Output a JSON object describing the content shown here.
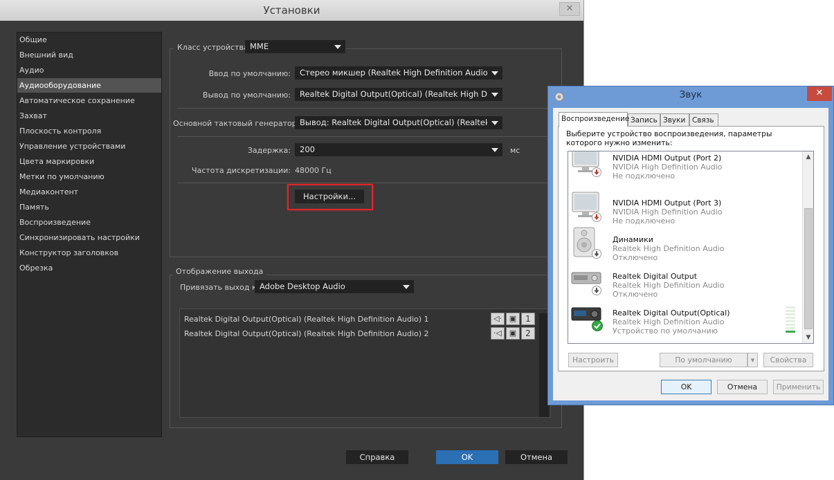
{
  "prefs": {
    "title": "Установки",
    "categories": [
      "Общие",
      "Внешний вид",
      "Аудио",
      "Аудиооборудование",
      "Автоматическое сохранение",
      "Захват",
      "Плоскость контроля",
      "Управление устройствами",
      "Цвета маркировки",
      "Метки по умолчанию",
      "Медиаконтент",
      "Память",
      "Воспроизведение",
      "Синхронизировать настройки",
      "Конструктор заголовков",
      "Обрезка"
    ],
    "selected_category": "Аудиооборудование",
    "device_class_label": "Класс устройства:",
    "device_class_value": "MME",
    "default_input_label": "Ввод по умолчанию:",
    "default_input_value": "Стерео микшер (Realtek High Definition Audio)",
    "default_output_label": "Вывод по умолчанию:",
    "default_output_value": "Realtek Digital Output(Optical) (Realtek High Definition Audio)",
    "master_clock_label": "Основной тактовый генератор:",
    "master_clock_value": "Вывод: Realtek Digital Output(Optical) (Realtek High Definition Audio)",
    "latency_label": "Задержка:",
    "latency_value": "200",
    "latency_unit": "мс",
    "sample_rate_label": "Частота дискретизации:",
    "sample_rate_value": "48000 Гц",
    "settings_button": "Настройки...",
    "output_mapping_title": "Отображение выхода",
    "map_output_label": "Привязать выход к:",
    "map_output_value": "Adobe Desktop Audio",
    "outputs": [
      {
        "name": "Realtek Digital Output(Optical) (Realtek High Definition Audio) 1",
        "channel": "1"
      },
      {
        "name": "Realtek Digital Output(Optical) (Realtek High Definition Audio) 2",
        "channel": "2"
      }
    ],
    "help_button": "Справка",
    "ok_button": "OK",
    "cancel_button": "Отмена",
    "highlight_color": "#e0262b"
  },
  "sound": {
    "title": "Звук",
    "tabs": [
      "Воспроизведение",
      "Запись",
      "Звуки",
      "Связь"
    ],
    "active_tab": "Воспроизведение",
    "description": "Выберите устройство воспроизведения, параметры которого нужно изменить:",
    "devices": [
      {
        "name": "NVIDIA HDMI Output (Port 2)",
        "driver": "NVIDIA High Definition Audio",
        "status": "Не подключено",
        "icon": "monitor-icon",
        "badge": "disconnected-icon"
      },
      {
        "name": "NVIDIA HDMI Output (Port 3)",
        "driver": "NVIDIA High Definition Audio",
        "status": "Не подключено",
        "icon": "monitor-icon",
        "badge": "disconnected-icon"
      },
      {
        "name": "Динамики",
        "driver": "Realtek High Definition Audio",
        "status": "Отключено",
        "icon": "speaker-icon",
        "badge": "disabled-icon"
      },
      {
        "name": "Realtek Digital Output",
        "driver": "Realtek High Definition Audio",
        "status": "Отключено",
        "icon": "receiver-icon",
        "badge": "disabled-icon"
      },
      {
        "name": "Realtek Digital Output(Optical)",
        "driver": "Realtek High Definition Audio",
        "status": "Устройство по умолчанию",
        "icon": "receiver-icon",
        "badge": "default-check-icon"
      }
    ],
    "configure_button": "Настроить",
    "set_default_button": "По умолчанию",
    "properties_button": "Свойства",
    "ok_button": "OK",
    "cancel_button": "Отмена",
    "apply_button": "Применить"
  }
}
